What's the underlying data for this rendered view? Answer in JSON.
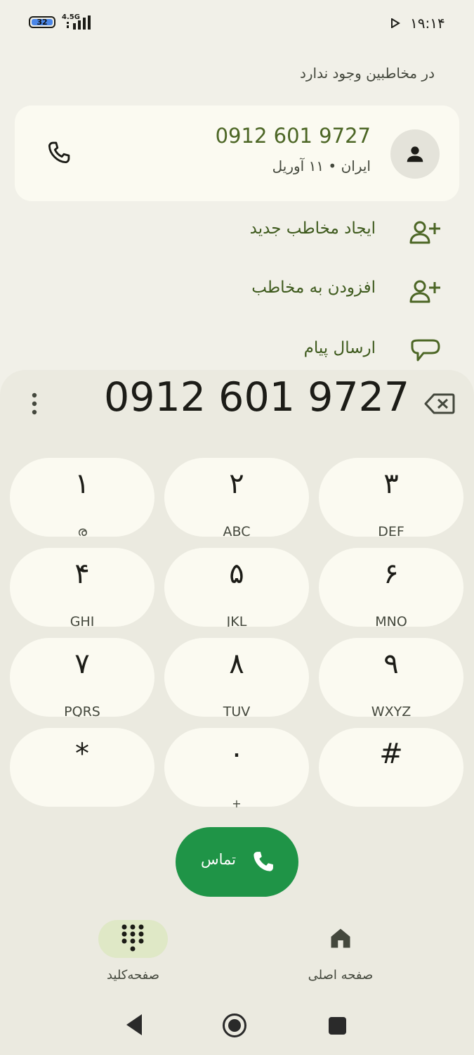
{
  "status_bar": {
    "battery": "32",
    "network": "4.5G",
    "time": "۱۹:۱۴"
  },
  "lookup": {
    "no_contact_text": "در مخاطبین وجود ندارد",
    "number": "0912 601 9727",
    "subtitle": "ایران • ۱۱ آوریل"
  },
  "actions": [
    {
      "label": "ایجاد مخاطب جدید",
      "icon": "add-person-icon"
    },
    {
      "label": "افزودن به مخاطب",
      "icon": "add-person-icon"
    },
    {
      "label": "ارسال پیام",
      "icon": "message-icon"
    }
  ],
  "dialpad": {
    "entered_number": "0912 601 9727",
    "keys": [
      {
        "digit": "۱",
        "letters": "ര"
      },
      {
        "digit": "۲",
        "letters": "ABC"
      },
      {
        "digit": "۳",
        "letters": "DEF"
      },
      {
        "digit": "۴",
        "letters": "GHI"
      },
      {
        "digit": "۵",
        "letters": "JKL"
      },
      {
        "digit": "۶",
        "letters": "MNO"
      },
      {
        "digit": "۷",
        "letters": "PQRS"
      },
      {
        "digit": "۸",
        "letters": "TUV"
      },
      {
        "digit": "۹",
        "letters": "WXYZ"
      },
      {
        "digit": "*",
        "letters": ""
      },
      {
        "digit": "۰",
        "letters": "+"
      },
      {
        "digit": "#",
        "letters": ""
      }
    ],
    "call_label": "تماس"
  },
  "bottom_nav": {
    "keypad_label": "صفحه‌کلید",
    "home_label": "صفحه اصلی"
  },
  "colors": {
    "accent_green": "#4c6625",
    "call_green": "#1f9447",
    "card_bg": "#fbfaf1"
  }
}
